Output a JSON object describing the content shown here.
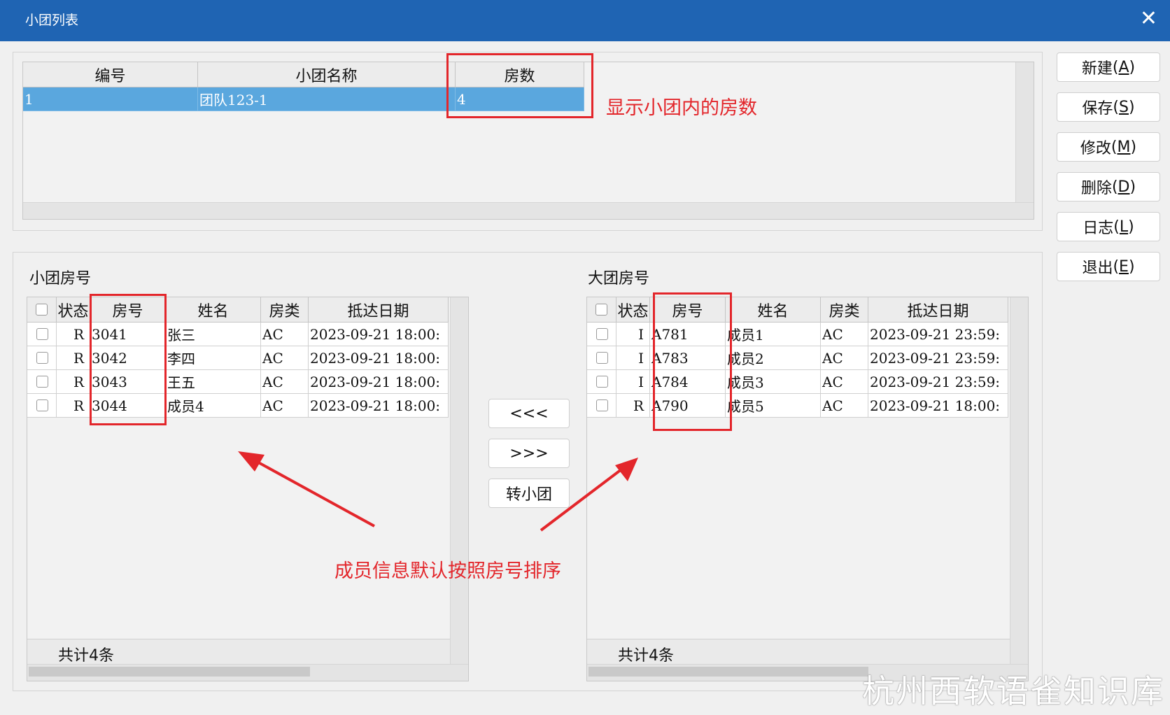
{
  "window": {
    "title": "小团列表",
    "close_glyph": "✕"
  },
  "group_list": {
    "columns": [
      "编号",
      "小团名称",
      "房数"
    ],
    "rows": [
      {
        "id": "1",
        "name": "团队123-1",
        "rooms": "4",
        "selected": true
      }
    ]
  },
  "side_buttons": [
    {
      "label": "新建",
      "key": "A"
    },
    {
      "label": "保存",
      "key": "S"
    },
    {
      "label": "修改",
      "key": "M"
    },
    {
      "label": "删除",
      "key": "D"
    },
    {
      "label": "日志",
      "key": "L"
    },
    {
      "label": "退出",
      "key": "E"
    }
  ],
  "small_group": {
    "title": "小团房号",
    "columns": [
      "状态",
      "房号",
      "姓名",
      "房类",
      "抵达日期"
    ],
    "rows": [
      {
        "status": "R",
        "room": "3041",
        "name": "张三",
        "type": "AC",
        "arrival": "2023-09-21 18:00:"
      },
      {
        "status": "R",
        "room": "3042",
        "name": "李四",
        "type": "AC",
        "arrival": "2023-09-21 18:00:"
      },
      {
        "status": "R",
        "room": "3043",
        "name": "王五",
        "type": "AC",
        "arrival": "2023-09-21 18:00:"
      },
      {
        "status": "R",
        "room": "3044",
        "name": "成员4",
        "type": "AC",
        "arrival": "2023-09-21 18:00:"
      }
    ],
    "footer": "共计4条"
  },
  "big_group": {
    "title": "大团房号",
    "columns": [
      "状态",
      "房号",
      "姓名",
      "房类",
      "抵达日期"
    ],
    "rows": [
      {
        "status": "I",
        "room": "A781",
        "name": "成员1",
        "type": "AC",
        "arrival": "2023-09-21 23:59:"
      },
      {
        "status": "I",
        "room": "A783",
        "name": "成员2",
        "type": "AC",
        "arrival": "2023-09-21 23:59:"
      },
      {
        "status": "I",
        "room": "A784",
        "name": "成员3",
        "type": "AC",
        "arrival": "2023-09-21 23:59:"
      },
      {
        "status": "R",
        "room": "A790",
        "name": "成员5",
        "type": "AC",
        "arrival": "2023-09-21 18:00:"
      }
    ],
    "footer": "共计4条"
  },
  "transfer_buttons": {
    "move_left": "<<<",
    "move_right": ">>>",
    "to_small": "转小团"
  },
  "annotations": {
    "rooms_count": "显示小团内的房数",
    "sorting": "成员信息默认按照房号排序"
  },
  "watermark": "杭州西软语雀知识库",
  "colors": {
    "titlebar": "#1f64b3",
    "selection": "#5aa7de",
    "annotation": "#e3262b"
  }
}
